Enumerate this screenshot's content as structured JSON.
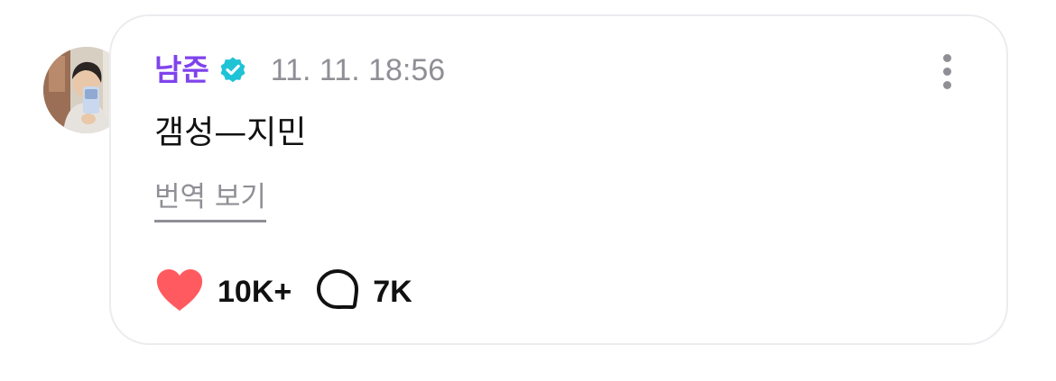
{
  "post": {
    "author": "남준",
    "verified_icon": "verified-badge-icon",
    "timestamp": "11. 11. 18:56",
    "text": "갬성—지민",
    "translate_label": "번역 보기",
    "more_icon": "more-vertical-icon"
  },
  "reactions": {
    "likes_icon": "heart-icon",
    "likes": "10K+",
    "comments_icon": "comment-bubble-icon",
    "comments": "7K"
  },
  "colors": {
    "author": "#7f43ec",
    "verified": "#1fc3d6",
    "heart": "#ff5a5f",
    "muted": "#8f8f96",
    "card_border": "#ececf0"
  }
}
